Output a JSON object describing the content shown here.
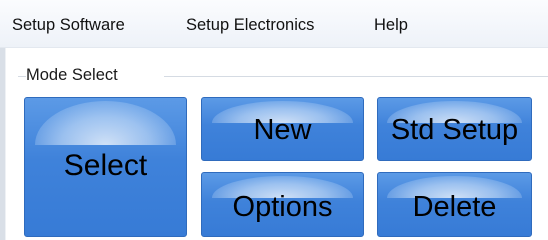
{
  "menubar": {
    "items": [
      {
        "label": "Setup Software"
      },
      {
        "label": "Setup Electronics"
      },
      {
        "label": "Help"
      }
    ]
  },
  "mode_select": {
    "title": "Mode Select",
    "buttons": {
      "select": "Select",
      "new": "New",
      "std_setup": "Std Setup",
      "options": "Options",
      "delete": "Delete"
    }
  },
  "colors": {
    "button_blue": "#3f82da",
    "menubar_bg": "#f3f6fb"
  }
}
